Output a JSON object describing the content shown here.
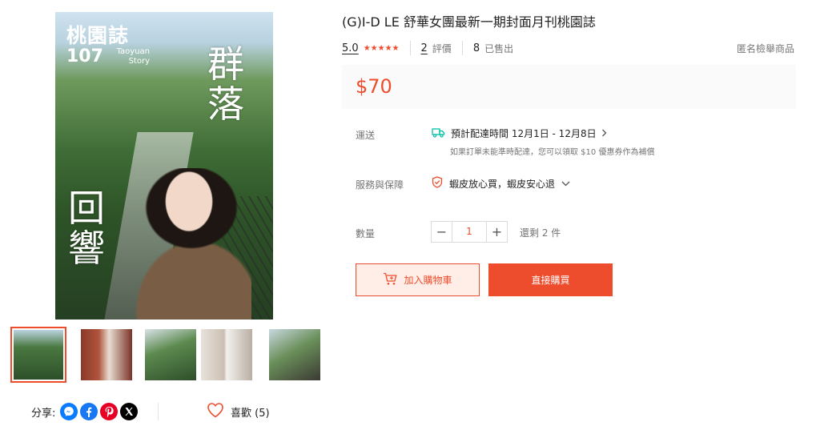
{
  "gallery": {
    "cover": {
      "title": "桃園誌",
      "issue": "107",
      "subtitle": "Taoyuan Story",
      "headline_top": "群落",
      "headline_bottom": "回響"
    },
    "thumbnail_count": 5,
    "active_thumbnail": 0
  },
  "share": {
    "label": "分享:",
    "icons": [
      "messenger-icon",
      "facebook-icon",
      "pinterest-icon",
      "x-icon"
    ],
    "colors": {
      "messenger": "#0a7cff",
      "facebook": "#1877f2",
      "pinterest": "#e60023",
      "x": "#000000"
    }
  },
  "like": {
    "label": "喜歡 (5)"
  },
  "product": {
    "title": "(G)I-D LE 舒華女團最新一期封面月刊桃園誌",
    "rating": "5.0",
    "stars": 5,
    "reviews_count": "2",
    "reviews_label": "評價",
    "sold_count": "8",
    "sold_label": "已售出",
    "report_label": "匿名檢舉商品",
    "price": "$70",
    "accent_color": "#ee4d2d"
  },
  "shipping": {
    "label": "運送",
    "estimate": "預計配達時間 12月1日 - 12月8日",
    "note": "如果訂單未能準時配達，您可以領取 $10 優惠券作為補償"
  },
  "guarantee": {
    "label": "服務與保障",
    "text": "蝦皮放心買，蝦皮安心退"
  },
  "quantity": {
    "label": "數量",
    "value": "1",
    "minus": "−",
    "plus": "+",
    "stock": "還剩 2 件"
  },
  "actions": {
    "add_to_cart": "加入購物車",
    "buy_now": "直接購買"
  }
}
